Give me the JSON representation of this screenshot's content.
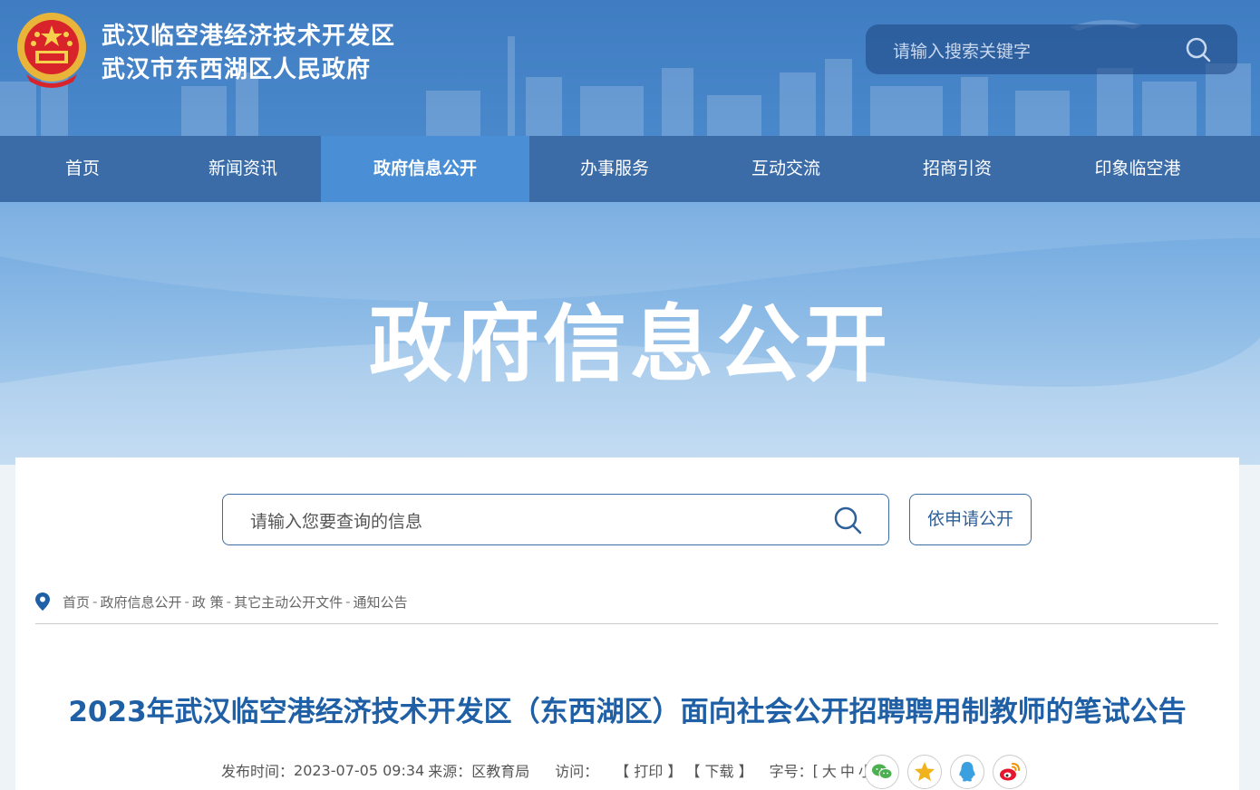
{
  "header": {
    "title_line1": "武汉临空港经济技术开发区",
    "title_line2": "武汉市东西湖区人民政府",
    "search_placeholder": "请输入搜索关键字"
  },
  "nav": {
    "items": [
      {
        "label": "首页"
      },
      {
        "label": "新闻资讯"
      },
      {
        "label": "政府信息公开",
        "active": true
      },
      {
        "label": "办事服务"
      },
      {
        "label": "互动交流"
      },
      {
        "label": "招商引资"
      },
      {
        "label": "印象临空港"
      }
    ]
  },
  "banner": {
    "title": "政府信息公开"
  },
  "search": {
    "placeholder": "请输入您要查询的信息",
    "apply_button": "依申请公开"
  },
  "breadcrumb": [
    "首页",
    "政府信息公开",
    "政 策",
    "其它主动公开文件",
    "通知公告"
  ],
  "article": {
    "title": "2023年武汉临空港经济技术开发区（东西湖区）面向社会公开招聘聘用制教师的笔试公告",
    "publish_label": "发布时间：",
    "publish_time": "2023-07-05 09:34",
    "source_label": "来源：",
    "source": "区教育局",
    "visit_label": "访问：",
    "print": "【 打印 】",
    "download": "【 下载 】",
    "fontsize_label": "字号：",
    "fontsize_open": "[",
    "fontsize_large": "大",
    "fontsize_medium": "中",
    "fontsize_small": "小",
    "fontsize_close": "]"
  },
  "share_icons": [
    "wechat-icon",
    "qzone-icon",
    "qq-icon",
    "weibo-icon"
  ],
  "colors": {
    "header_bg": "#4a88cc",
    "nav_bg": "#3b6ca8",
    "nav_active": "#4a8fd6",
    "title_blue": "#1f5fa5",
    "wechat": "#4caf50",
    "qzone": "#f2b21c",
    "qq": "#3aa0e0",
    "weibo": "#e6162d"
  }
}
